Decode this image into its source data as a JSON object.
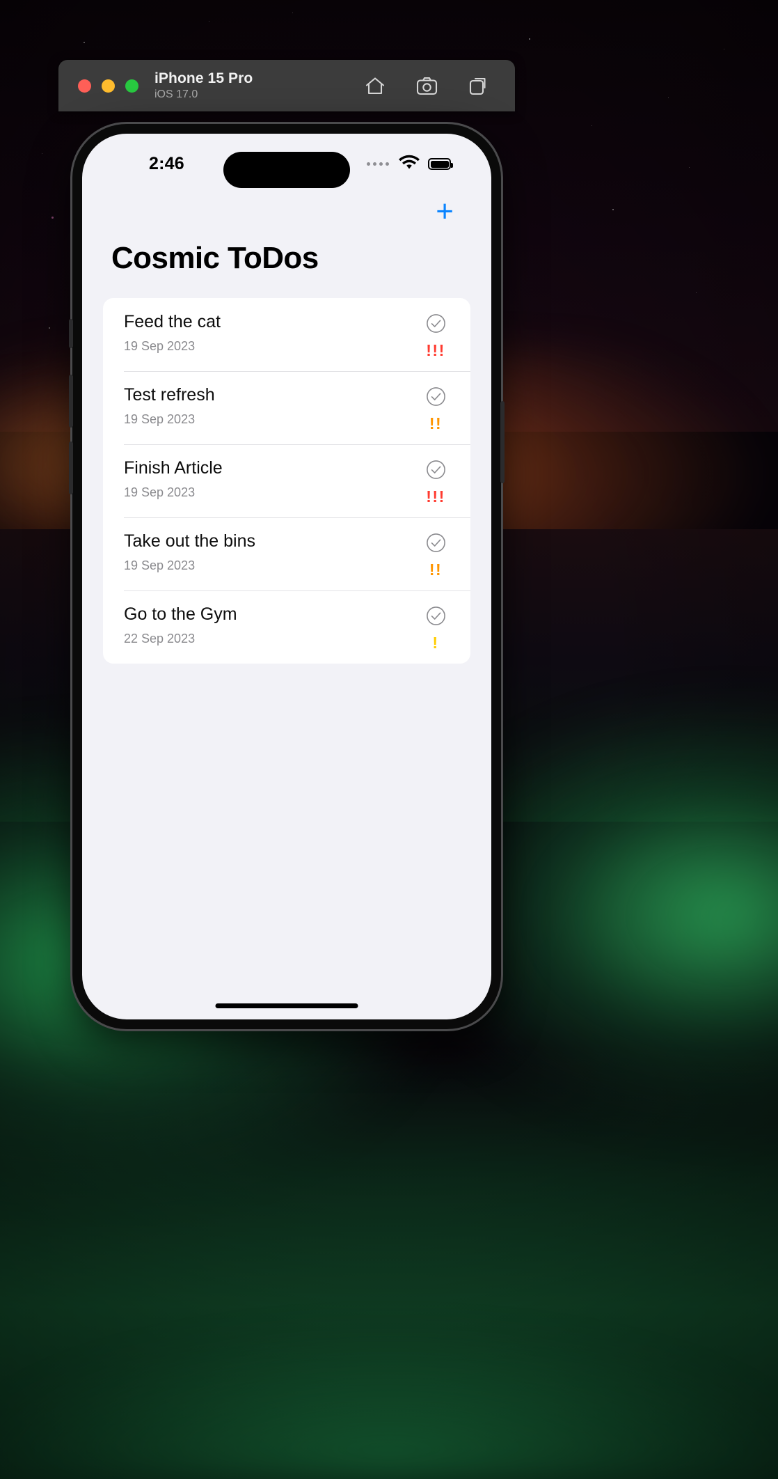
{
  "simulator": {
    "name": "iPhone 15 Pro",
    "os_version": "iOS 17.0",
    "traffic_lights": [
      {
        "name": "close",
        "color": "#ff5f57"
      },
      {
        "name": "minimize",
        "color": "#febc2e"
      },
      {
        "name": "zoom",
        "color": "#28c840"
      }
    ],
    "toolbar_icons": [
      "home-icon",
      "screenshot-icon",
      "rotate-icon"
    ]
  },
  "status_bar": {
    "time": "2:46",
    "signal_icon": "signal-dots-icon",
    "wifi_icon": "wifi-icon",
    "battery_icon": "battery-icon"
  },
  "app": {
    "title": "Cosmic ToDos",
    "add_button_label": "+",
    "accent_color": "#0a84ff",
    "background_color": "#f2f2f7",
    "card_color": "#ffffff",
    "priority_colors": {
      "high": "#ff3b30",
      "medium": "#ff9500",
      "low": "#ffcc00"
    },
    "todos": [
      {
        "title": "Feed the cat",
        "date": "19 Sep 2023",
        "priority_marks": "!!!",
        "priority_level": "high",
        "priority_color": "#ff3b30",
        "completed": false
      },
      {
        "title": "Test refresh",
        "date": "19 Sep 2023",
        "priority_marks": "!!",
        "priority_level": "medium",
        "priority_color": "#ff9500",
        "completed": false
      },
      {
        "title": "Finish Article",
        "date": "19 Sep 2023",
        "priority_marks": "!!!",
        "priority_level": "high",
        "priority_color": "#ff3b30",
        "completed": false
      },
      {
        "title": "Take out the bins",
        "date": "19 Sep 2023",
        "priority_marks": "!!",
        "priority_level": "medium",
        "priority_color": "#ff9500",
        "completed": false
      },
      {
        "title": "Go to the Gym",
        "date": "22 Sep 2023",
        "priority_marks": "!",
        "priority_level": "low",
        "priority_color": "#ffcc00",
        "completed": false
      }
    ]
  }
}
